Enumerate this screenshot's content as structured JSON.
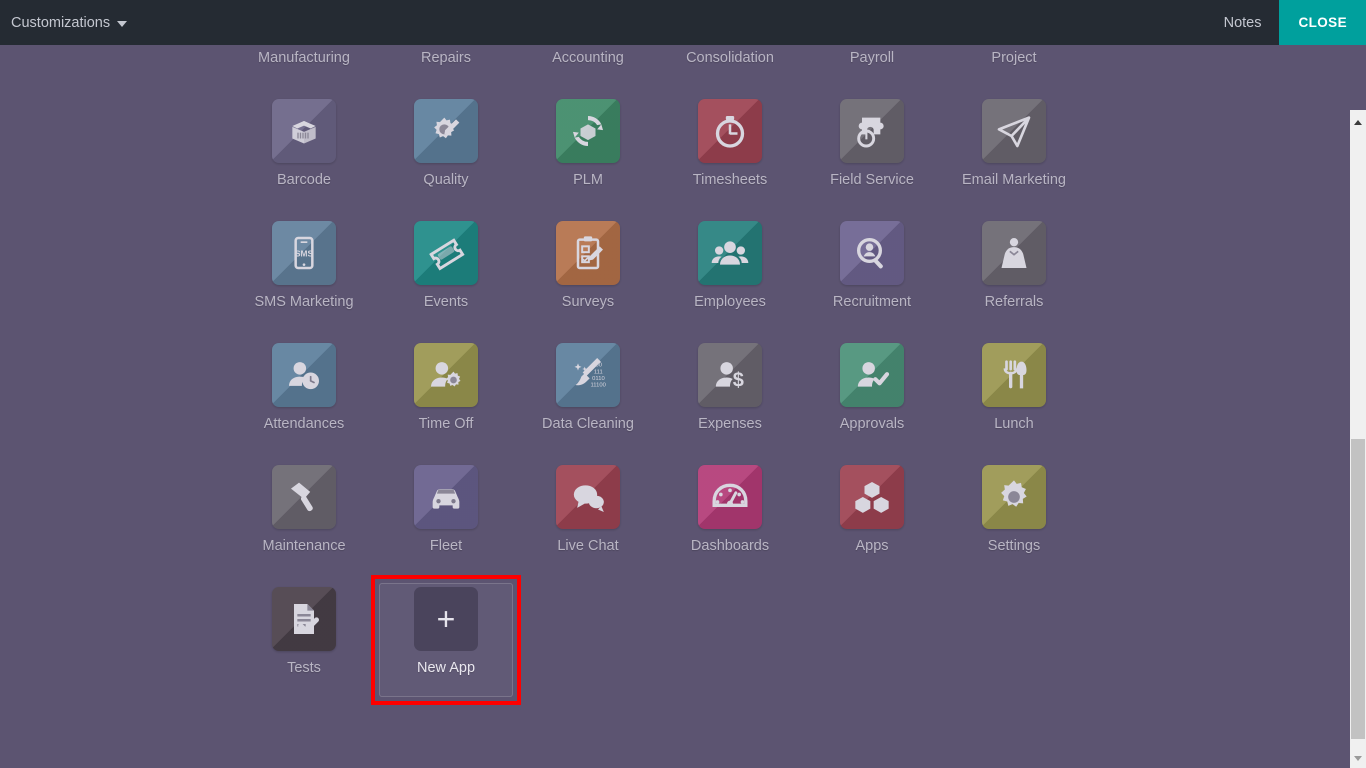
{
  "topbar": {
    "brand_label": "Customizations",
    "brand_icon": "chevron-down-icon",
    "notes_label": "Notes",
    "close_label": "CLOSE",
    "close_bg": "#00a09d",
    "bg": "#252b33"
  },
  "theme": {
    "background": "#5c5471",
    "label_color": "#b9b5c4",
    "highlight_color": "#fe0000"
  },
  "scrollbar": {
    "orientation": "vertical",
    "up_icon": "triangle-up-icon",
    "down_icon": "triangle-down-icon",
    "thumb_name": "scrollbar-thumb"
  },
  "apps": [
    {
      "label": "Manufacturing",
      "icon": "manufacturing-icon",
      "color": "#4f7d5f",
      "clipped": true
    },
    {
      "label": "Repairs",
      "icon": "repairs-icon",
      "color": "#4f7d5f",
      "clipped": true
    },
    {
      "label": "Accounting",
      "icon": "accounting-icon",
      "color": "#b0305c",
      "clipped": true
    },
    {
      "label": "Consolidation",
      "icon": "consolidation-icon",
      "color": "#4f7d5f",
      "clipped": true
    },
    {
      "label": "Payroll",
      "icon": "payroll-icon",
      "color": "#b0305c",
      "clipped": true
    },
    {
      "label": "Project",
      "icon": "project-icon",
      "color": "#6a6a94",
      "clipped": true
    },
    {
      "label": "Barcode",
      "icon": "open-box-barcode-icon",
      "color": "#6b6487"
    },
    {
      "label": "Quality",
      "icon": "gear-pencil-icon",
      "color": "#5d7f9c"
    },
    {
      "label": "PLM",
      "icon": "cycle-box-icon",
      "color": "#3f8a68"
    },
    {
      "label": "Timesheets",
      "icon": "stopwatch-icon",
      "color": "#9d4352"
    },
    {
      "label": "Field Service",
      "icon": "puzzle-stopwatch-icon",
      "color": "#6b6770"
    },
    {
      "label": "Email Marketing",
      "icon": "paper-plane-icon",
      "color": "#6b6770"
    },
    {
      "label": "SMS Marketing",
      "icon": "phone-sms-icon",
      "color": "#62809c"
    },
    {
      "label": "Events",
      "icon": "ticket-icon",
      "color": "#1f8a87"
    },
    {
      "label": "Surveys",
      "icon": "clipboard-pencil-icon",
      "color": "#b4714a"
    },
    {
      "label": "Employees",
      "icon": "people-group-icon",
      "color": "#27807e"
    },
    {
      "label": "Recruitment",
      "icon": "person-magnifier-icon",
      "color": "#6d6390"
    },
    {
      "label": "Referrals",
      "icon": "hero-cape-icon",
      "color": "#6b6770"
    },
    {
      "label": "Attendances",
      "icon": "person-clock-icon",
      "color": "#5d7f9c"
    },
    {
      "label": "Time Off",
      "icon": "person-gear-icon",
      "color": "#9a9650"
    },
    {
      "label": "Data Cleaning",
      "icon": "broom-binary-icon",
      "color": "#5d7f9c"
    },
    {
      "label": "Expenses",
      "icon": "person-dollar-icon",
      "color": "#6b6770"
    },
    {
      "label": "Approvals",
      "icon": "person-check-icon",
      "color": "#4b9178"
    },
    {
      "label": "Lunch",
      "icon": "fork-knife-icon",
      "color": "#9a9650"
    },
    {
      "label": "Maintenance",
      "icon": "hammer-icon",
      "color": "#6b6770"
    },
    {
      "label": "Fleet",
      "icon": "car-icon",
      "color": "#675f8c"
    },
    {
      "label": "Live Chat",
      "icon": "speech-bubbles-icon",
      "color": "#9d4352"
    },
    {
      "label": "Dashboards",
      "icon": "gauge-icon",
      "color": "#b33b77"
    },
    {
      "label": "Apps",
      "icon": "cubes-icon",
      "color": "#9d4352"
    },
    {
      "label": "Settings",
      "icon": "gear-icon",
      "color": "#9a9650"
    },
    {
      "label": "Tests",
      "icon": "document-check-icon",
      "color": "#4a4049"
    },
    {
      "label": "New App",
      "icon": "plus-icon",
      "color": "#4a445c",
      "highlighted": true
    }
  ]
}
